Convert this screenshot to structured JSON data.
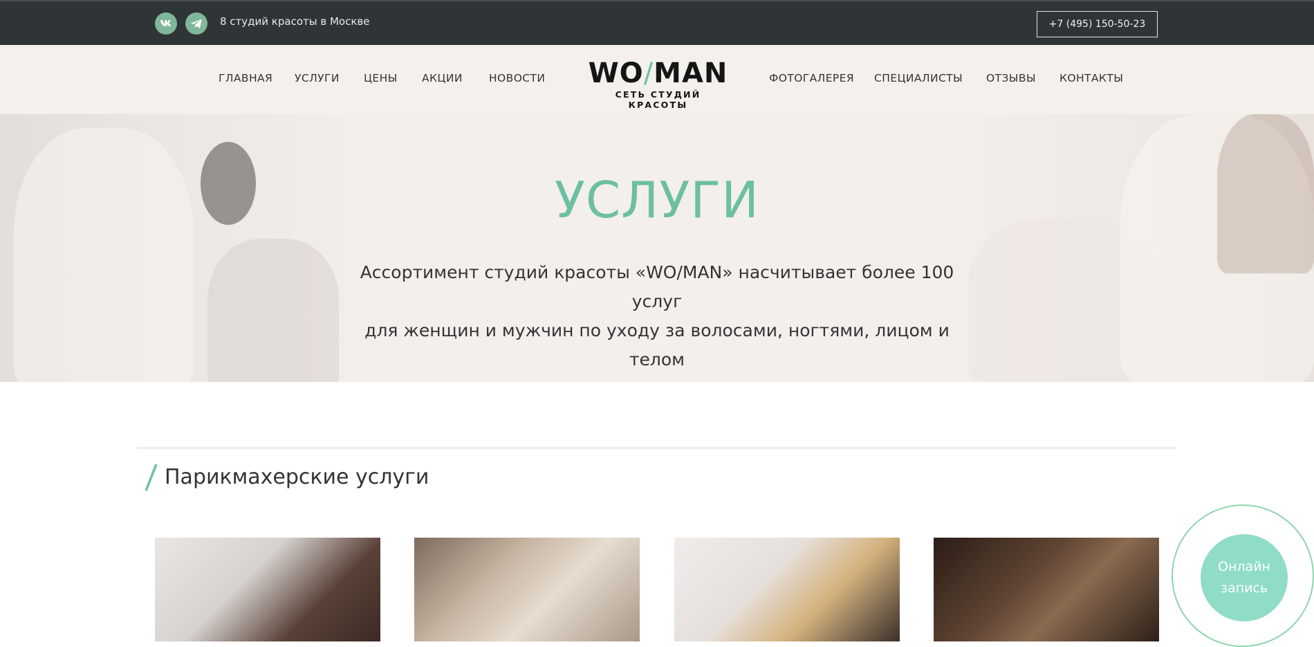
{
  "topbar": {
    "social": [
      {
        "name": "vk-icon",
        "label": "VK"
      },
      {
        "name": "telegram-icon",
        "label": "Telegram"
      }
    ],
    "city_text": "8 студий красоты в Москве",
    "phone": "+7 (495) 150-50-23"
  },
  "header": {
    "nav_left": [
      "ГЛАВНАЯ",
      "УСЛУГИ",
      "ЦЕНЫ",
      "АКЦИИ",
      "НОВОСТИ"
    ],
    "nav_right": [
      "ФОТОГАЛЕРЕЯ",
      "СПЕЦИАЛИСТЫ",
      "ОТЗЫВЫ",
      "КОНТАКТЫ"
    ],
    "logo_left": "WO",
    "logo_slash": "/",
    "logo_right": "MAN",
    "logo_sub": "СЕТЬ СТУДИЙ КРАСОТЫ"
  },
  "hero": {
    "title": "УСЛУГИ",
    "description_line1": "Ассортимент студий красоты «WO/MAN» насчитывает более 100 услуг",
    "description_line2": "для женщин и мужчин по уходу за волосами, ногтями, лицом и телом"
  },
  "section": {
    "title": "Парикмахерские услуги"
  },
  "booking": {
    "line1": "Онлайн",
    "line2": "запись"
  },
  "colors": {
    "accent": "#6cbfa2",
    "topbar_bg": "#2f3436",
    "header_bg": "#f4f1ed",
    "booking_bg": "#8fdcc7"
  }
}
